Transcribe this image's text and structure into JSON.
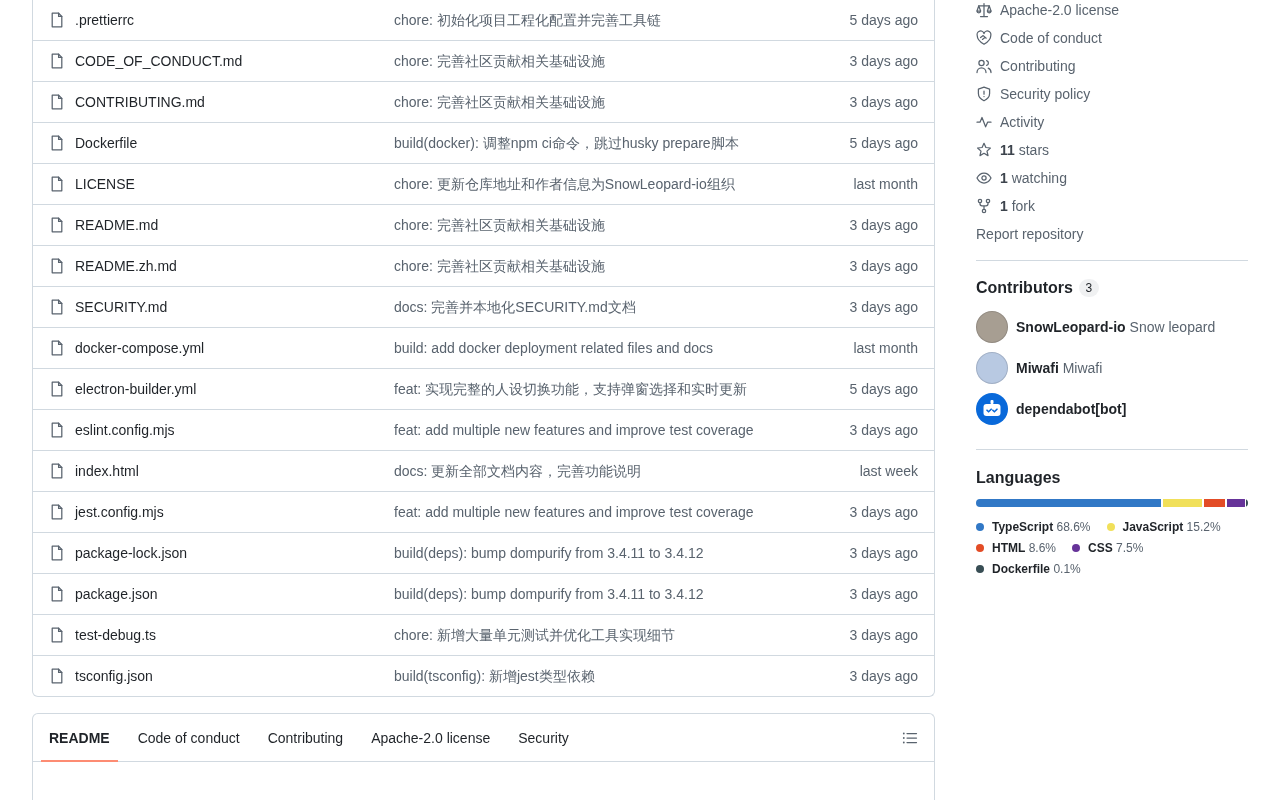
{
  "files": [
    {
      "name": ".prettierrc",
      "message": "chore: 初始化项目工程化配置并完善工具链",
      "time": "5 days ago"
    },
    {
      "name": "CODE_OF_CONDUCT.md",
      "message": "chore: 完善社区贡献相关基础设施",
      "time": "3 days ago"
    },
    {
      "name": "CONTRIBUTING.md",
      "message": "chore: 完善社区贡献相关基础设施",
      "time": "3 days ago"
    },
    {
      "name": "Dockerfile",
      "message": "build(docker): 调整npm ci命令，跳过husky prepare脚本",
      "time": "5 days ago"
    },
    {
      "name": "LICENSE",
      "message": "chore: 更新仓库地址和作者信息为SnowLeopard-io组织",
      "time": "last month"
    },
    {
      "name": "README.md",
      "message": "chore: 完善社区贡献相关基础设施",
      "time": "3 days ago"
    },
    {
      "name": "README.zh.md",
      "message": "chore: 完善社区贡献相关基础设施",
      "time": "3 days ago"
    },
    {
      "name": "SECURITY.md",
      "message": "docs: 完善并本地化SECURITY.md文档",
      "time": "3 days ago"
    },
    {
      "name": "docker-compose.yml",
      "message": "build: add docker deployment related files and docs",
      "time": "last month"
    },
    {
      "name": "electron-builder.yml",
      "message": "feat: 实现完整的人设切换功能，支持弹窗选择和实时更新",
      "time": "5 days ago"
    },
    {
      "name": "eslint.config.mjs",
      "message": "feat: add multiple new features and improve test coverage",
      "time": "3 days ago"
    },
    {
      "name": "index.html",
      "message": "docs: 更新全部文档内容，完善功能说明",
      "time": "last week"
    },
    {
      "name": "jest.config.mjs",
      "message": "feat: add multiple new features and improve test coverage",
      "time": "3 days ago"
    },
    {
      "name": "package-lock.json",
      "message": "build(deps): bump dompurify from 3.4.11 to 3.4.12",
      "time": "3 days ago"
    },
    {
      "name": "package.json",
      "message": "build(deps): bump dompurify from 3.4.11 to 3.4.12",
      "time": "3 days ago"
    },
    {
      "name": "test-debug.ts",
      "message": "chore: 新增大量单元测试并优化工具实现细节",
      "time": "3 days ago"
    },
    {
      "name": "tsconfig.json",
      "message": "build(tsconfig): 新增jest类型依赖",
      "time": "3 days ago"
    }
  ],
  "readme": {
    "tabs": [
      {
        "label": "README",
        "selected": true
      },
      {
        "label": "Code of conduct",
        "selected": false
      },
      {
        "label": "Contributing",
        "selected": false
      },
      {
        "label": "Apache-2.0 license",
        "selected": false
      },
      {
        "label": "Security",
        "selected": false
      }
    ]
  },
  "about": {
    "links": [
      {
        "kind": "license",
        "label": "Apache-2.0 license"
      },
      {
        "kind": "conduct",
        "label": "Code of conduct"
      },
      {
        "kind": "contributing",
        "label": "Contributing"
      },
      {
        "kind": "security",
        "label": "Security policy"
      },
      {
        "kind": "activity",
        "label": "Activity"
      },
      {
        "kind": "stars",
        "count": "11",
        "label": "stars"
      },
      {
        "kind": "watching",
        "count": "1",
        "label": "watching"
      },
      {
        "kind": "forks",
        "count": "1",
        "label": "fork"
      }
    ],
    "report_link": "Report repository"
  },
  "contributors": {
    "title": "Contributors",
    "count": "3",
    "people": [
      {
        "kind": "photo",
        "login": "SnowLeopard-io",
        "name": "Snow leopard"
      },
      {
        "kind": "photo",
        "login": "Miwafi",
        "name": "Miwafi"
      },
      {
        "kind": "bot",
        "login": "dependabot[bot]"
      }
    ]
  },
  "languages": {
    "title": "Languages",
    "items": [
      {
        "name": "TypeScript",
        "percent": "68.6%",
        "color": "#3178c6"
      },
      {
        "name": "JavaScript",
        "percent": "15.2%",
        "color": "#f1e05a"
      },
      {
        "name": "HTML",
        "percent": "8.6%",
        "color": "#e34c26"
      },
      {
        "name": "CSS",
        "percent": "7.5%",
        "color": "#663399"
      },
      {
        "name": "Dockerfile",
        "percent": "0.1%",
        "color": "#384d54"
      }
    ]
  }
}
